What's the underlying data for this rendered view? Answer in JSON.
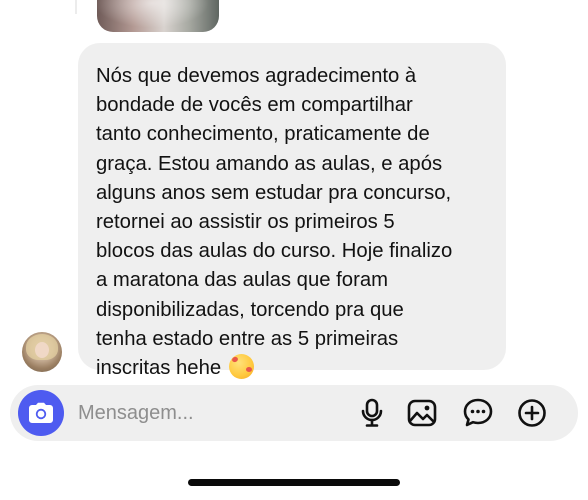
{
  "message": {
    "lines": [
      "Nós que devemos agradecimento à",
      "bondade de vocês em compartilhar",
      "tanto conhecimento, praticamente de",
      "graça. Estou amando as aulas, e após",
      "alguns anos sem estudar pra concurso,",
      "retornei ao assistir os primeiros 5",
      "blocos das aulas do curso. Hoje finalizo",
      "a maratona das aulas que foram",
      "disponibilizadas, torcendo pra que",
      "tenha estado entre as 5 primeiras",
      "inscritas hehe"
    ],
    "emoji": "smiling-face-with-hearts"
  },
  "composer": {
    "placeholder": "Mensagem...",
    "camera_icon": "camera-icon",
    "tools": [
      "microphone-icon",
      "image-icon",
      "sticker-chat-icon",
      "add-circle-icon"
    ]
  },
  "colors": {
    "bubble": "#efefef",
    "camera_button": "#4e5bf0",
    "text": "#121212",
    "placeholder": "#8e8e8e"
  }
}
